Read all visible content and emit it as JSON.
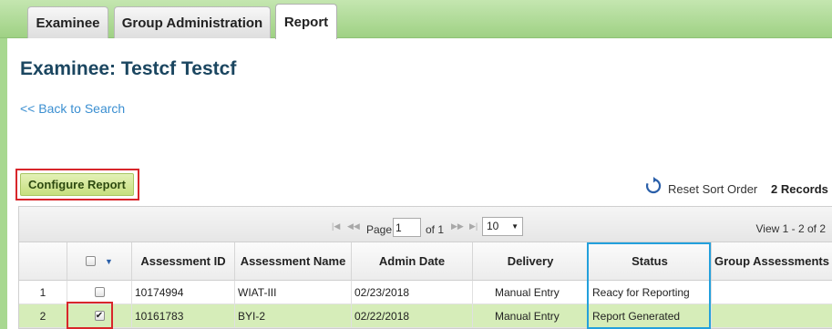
{
  "tabs": [
    {
      "label": "Examinee",
      "active": false
    },
    {
      "label": "Group Administration",
      "active": false
    },
    {
      "label": "Report",
      "active": true
    }
  ],
  "page_title": "Examinee: Testcf Testcf",
  "back_link": "<< Back to Search",
  "configure_button": "Configure Report",
  "reset_sort_label": "Reset Sort Order",
  "records_label": "2 Records",
  "pager": {
    "page_label": "Page",
    "page_value": "1",
    "of_label": "of 1",
    "page_size": "10",
    "view_label": "View 1 - 2 of 2"
  },
  "columns": {
    "assessment_id": "Assessment ID",
    "assessment_name": "Assessment Name",
    "admin_date": "Admin Date",
    "delivery": "Delivery",
    "status": "Status",
    "group_assessments": "Group Assessments"
  },
  "rows": [
    {
      "num": "1",
      "checked": false,
      "id": "10174994",
      "name": "WIAT-III",
      "date": "02/23/2018",
      "delivery": "Manual Entry",
      "status": "Reacy for Reporting",
      "group": ""
    },
    {
      "num": "2",
      "checked": true,
      "id": "10161783",
      "name": "BYI-2",
      "date": "02/22/2018",
      "delivery": "Manual Entry",
      "status": "Report Generated",
      "group": ""
    }
  ],
  "icons": {
    "reset": "refresh-icon",
    "pager_first": "first-page-icon",
    "pager_prev": "prev-page-icon",
    "pager_next": "next-page-icon",
    "pager_last": "last-page-icon",
    "sort": "chevron-down-icon"
  },
  "colors": {
    "tab_bar": "#9fd184",
    "title": "#1b4660",
    "link": "#3b8fd1",
    "selected_row": "#d6edb9",
    "highlight_red": "#d8262b",
    "highlight_blue": "#23a0dc"
  }
}
